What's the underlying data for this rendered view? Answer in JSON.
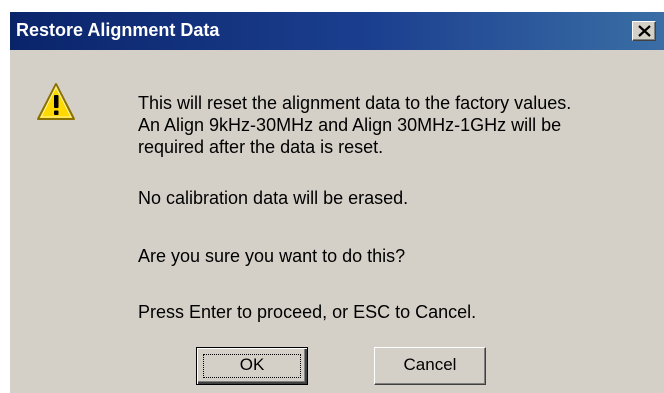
{
  "window": {
    "title": "Restore Alignment Data",
    "close_glyph": "✕"
  },
  "icon": {
    "name": "warning-icon",
    "color": "#ffd800"
  },
  "message": {
    "line1": "This will reset the alignment data to the factory values.",
    "line2": "An Align 9kHz-30MHz and Align 30MHz-1GHz will be",
    "line3": "required after the data is reset.",
    "line4": "No calibration data will be erased.",
    "line5": "Are you sure you want to do this?",
    "line6": "Press Enter to proceed, or ESC to Cancel."
  },
  "buttons": {
    "ok_label": "OK",
    "cancel_label": "Cancel"
  },
  "colors": {
    "title_bar": "#0a246a",
    "dialog_bg": "#d4d0c8",
    "text": "#000000"
  }
}
